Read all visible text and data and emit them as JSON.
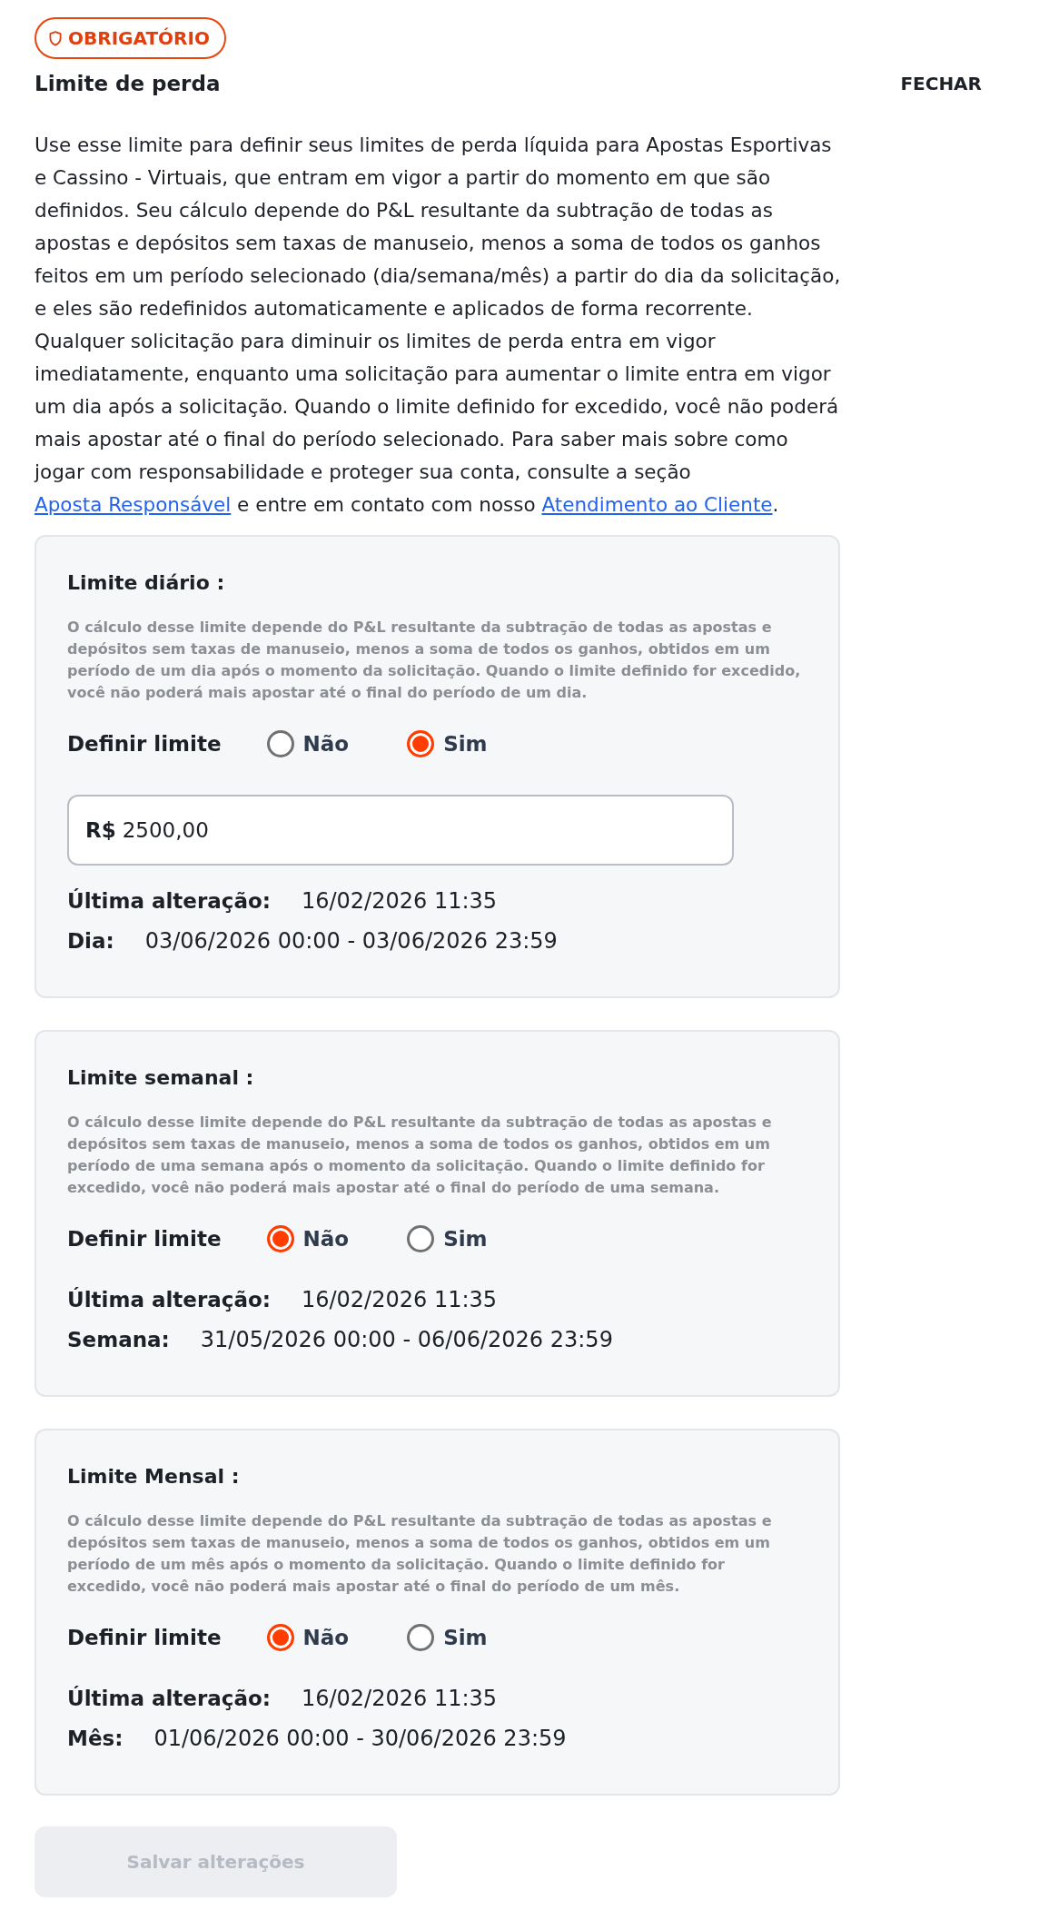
{
  "badge": {
    "label": "OBRIGATÓRIO"
  },
  "title": "Limite de perda",
  "close_button": {
    "label": "FECHAR"
  },
  "intro": [
    {
      "kind": "text",
      "text": "Use esse limite para definir seus limites de perda líquida para Apostas Esportivas e Cassino - Virtuais, que entram em vigor a partir do momento em que são definidos. Seu cálculo depende do P&L resultante da subtração de todas as apostas e depósitos sem taxas de manuseio, menos a soma de todos os ganhos feitos em um período selecionado (dia/semana/mês) a partir do dia da solicitação, e eles são redefinidos automaticamente e aplicados de forma recorrente. Qualquer solicitação para diminuir os limites de perda entra em vigor imediatamente, enquanto uma solicitação para aumentar o limite entra em vigor um dia após a solicitação. Quando o limite definido for excedido, você não poderá mais apostar até o final do período selecionado. Para saber mais sobre como jogar com responsabilidade e proteger sua conta, consulte a seção "
    },
    {
      "kind": "link",
      "text": "Aposta Responsável"
    },
    {
      "kind": "text",
      "text": " e entre em contato com nosso "
    },
    {
      "kind": "link",
      "text": "Atendimento ao Cliente"
    },
    {
      "kind": "text",
      "text": "."
    }
  ],
  "limits": [
    {
      "title": "Limite diário :",
      "description": "O cálculo desse limite depende do P&L resultante da subtração de todas as apostas e depósitos sem taxas de manuseio, menos a soma de todos os ganhos, obtidos em um período de um dia após o momento da solicitação. Quando o limite definido for excedido, você não poderá mais apostar até o final do período de um dia.",
      "define_label": "Definir limite",
      "options": [
        {
          "label": "Não",
          "selected": false
        },
        {
          "label": "Sim",
          "selected": true
        }
      ],
      "amount": {
        "currency": "R$",
        "value": "2500,00"
      },
      "info": [
        {
          "label": "Última alteração:",
          "value": "16/02/2026 11:35"
        },
        {
          "label": "Dia:",
          "value": "03/06/2026 00:00 - 03/06/2026 23:59"
        }
      ]
    },
    {
      "title": "Limite semanal :",
      "description": "O cálculo desse limite depende do P&L resultante da subtração de todas as apostas e depósitos sem taxas de manuseio, menos a soma de todos os ganhos, obtidos em um período de uma semana após o momento da solicitação. Quando o limite definido for excedido, você não poderá mais apostar até o final do período de uma semana.",
      "define_label": "Definir limite",
      "options": [
        {
          "label": "Não",
          "selected": true
        },
        {
          "label": "Sim",
          "selected": false
        }
      ],
      "info": [
        {
          "label": "Última alteração:",
          "value": "16/02/2026 11:35"
        },
        {
          "label": "Semana:",
          "value": "31/05/2026 00:00 - 06/06/2026 23:59"
        }
      ]
    },
    {
      "title": "Limite Mensal :",
      "description": "O cálculo desse limite depende do P&L resultante da subtração de todas as apostas e depósitos sem taxas de manuseio, menos a soma de todos os ganhos, obtidos em um período de um mês após o momento da solicitação. Quando o limite definido for excedido, você não poderá mais apostar até o final do período de um mês.",
      "define_label": "Definir limite",
      "options": [
        {
          "label": "Não",
          "selected": true
        },
        {
          "label": "Sim",
          "selected": false
        }
      ],
      "info": [
        {
          "label": "Última alteração:",
          "value": "16/02/2026 11:35"
        },
        {
          "label": "Mês:",
          "value": "01/06/2026 00:00 - 30/06/2026 23:59"
        }
      ]
    }
  ],
  "save_button": {
    "label": "Salvar alterações",
    "disabled": true
  }
}
